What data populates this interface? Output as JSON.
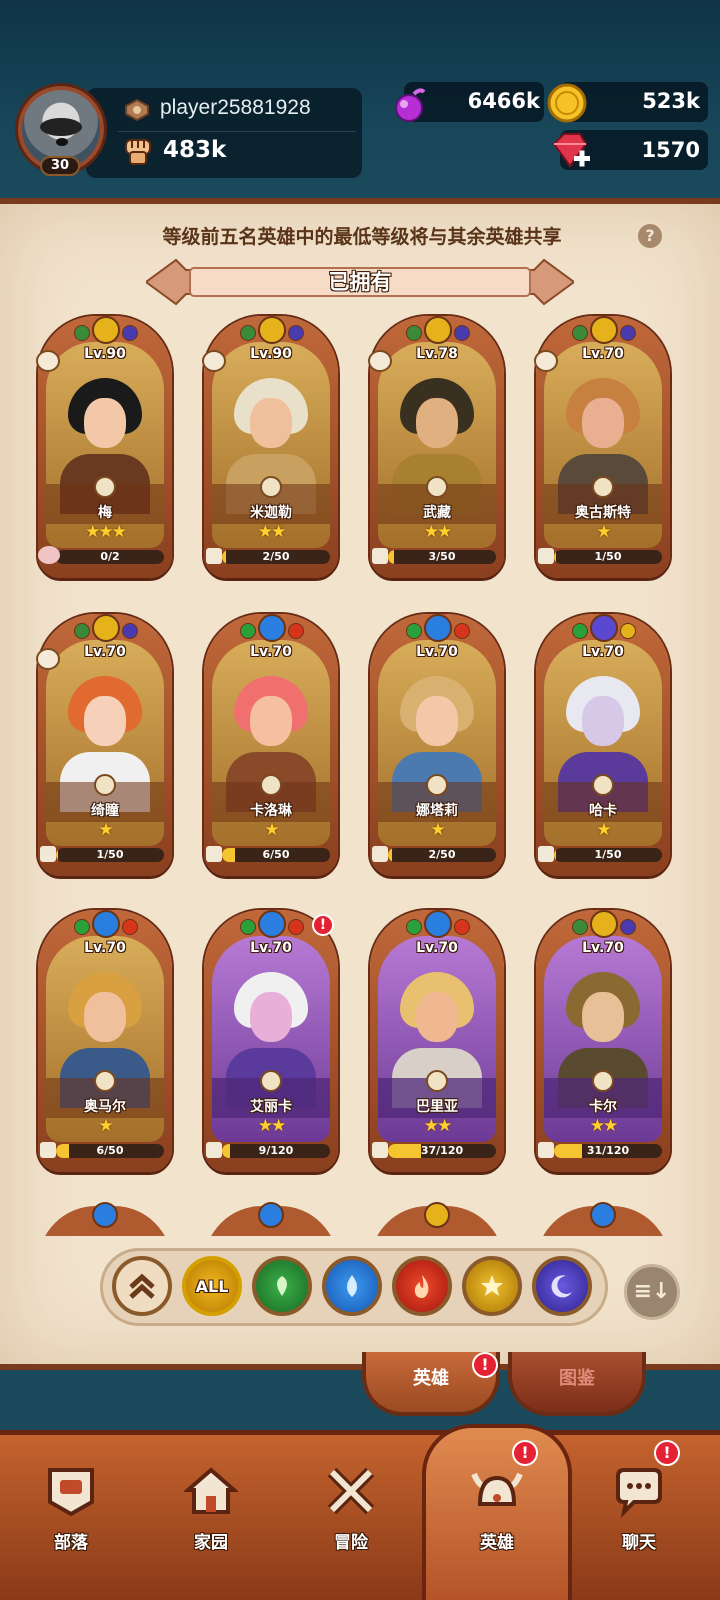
{
  "player": {
    "name": "player25881928",
    "level": "30",
    "power": "483k"
  },
  "resources": {
    "elixir": "6466k",
    "gold": "523k",
    "gems": "1570"
  },
  "notice": "等级前五名英雄中的最低等级将与其余英雄共享",
  "help": "?",
  "section_title": "已拥有",
  "heroes": [
    {
      "name": "梅",
      "level": "Lv.90",
      "stars": "★★★",
      "progress": "0/2",
      "progress_fraction": 0.0,
      "element": "light",
      "rarity": "legendary"
    },
    {
      "name": "米迦勒",
      "level": "Lv.90",
      "stars": "★★",
      "progress": "2/50",
      "progress_fraction": 0.04,
      "element": "light",
      "rarity": "legendary"
    },
    {
      "name": "武藏",
      "level": "Lv.78",
      "stars": "★★",
      "progress": "3/50",
      "progress_fraction": 0.06,
      "element": "light",
      "rarity": "legendary"
    },
    {
      "name": "奥古斯特",
      "level": "Lv.70",
      "stars": "★",
      "progress": "1/50",
      "progress_fraction": 0.02,
      "element": "light",
      "rarity": "legendary"
    },
    {
      "name": "绮瞳",
      "level": "Lv.70",
      "stars": "★",
      "progress": "1/50",
      "progress_fraction": 0.02,
      "element": "light",
      "rarity": "legendary"
    },
    {
      "name": "卡洛琳",
      "level": "Lv.70",
      "stars": "★",
      "progress": "6/50",
      "progress_fraction": 0.12,
      "element": "water",
      "rarity": "legendary"
    },
    {
      "name": "娜塔莉",
      "level": "Lv.70",
      "stars": "★",
      "progress": "2/50",
      "progress_fraction": 0.04,
      "element": "water",
      "rarity": "legendary"
    },
    {
      "name": "哈卡",
      "level": "Lv.70",
      "stars": "★",
      "progress": "1/50",
      "progress_fraction": 0.02,
      "element": "dark",
      "rarity": "legendary"
    },
    {
      "name": "奥马尔",
      "level": "Lv.70",
      "stars": "★",
      "progress": "6/50",
      "progress_fraction": 0.12,
      "element": "water",
      "rarity": "legendary"
    },
    {
      "name": "艾丽卡",
      "level": "Lv.70",
      "stars": "★★",
      "progress": "9/120",
      "progress_fraction": 0.075,
      "element": "water",
      "rarity": "epic"
    },
    {
      "name": "巴里亚",
      "level": "Lv.70",
      "stars": "★★",
      "progress": "37/120",
      "progress_fraction": 0.31,
      "element": "water",
      "rarity": "epic"
    },
    {
      "name": "卡尔",
      "level": "Lv.70",
      "stars": "★★",
      "progress": "31/120",
      "progress_fraction": 0.26,
      "element": "light",
      "rarity": "epic"
    }
  ],
  "filters": {
    "all_label": "ALL",
    "items": [
      "collapse",
      "all",
      "nature",
      "water",
      "fire",
      "light",
      "dark"
    ]
  },
  "sort_label": "≡↓",
  "subtabs": {
    "heroes": "英雄",
    "codex": "图鉴"
  },
  "nav": {
    "tribe": "部落",
    "home": "家园",
    "adventure": "冒险",
    "heroes": "英雄",
    "chat": "聊天"
  },
  "alert_mark": "!",
  "colors": {
    "header_bg": "#19485b",
    "parchment": "#f2e3cd",
    "card_frame": "#b05a30",
    "star": "#ffcf2e",
    "alert": "#e52233"
  }
}
